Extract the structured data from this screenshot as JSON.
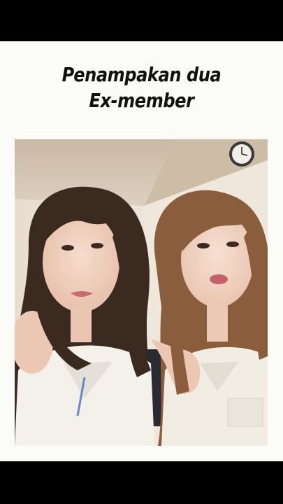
{
  "caption": {
    "line1": "Penampakan dua",
    "line2": "Ex-member"
  },
  "photo": {
    "icon": "video-frame-two-people"
  },
  "colors": {
    "letterbox": "#000000",
    "card": "#fbfbf8",
    "caption_text": "#111111"
  }
}
